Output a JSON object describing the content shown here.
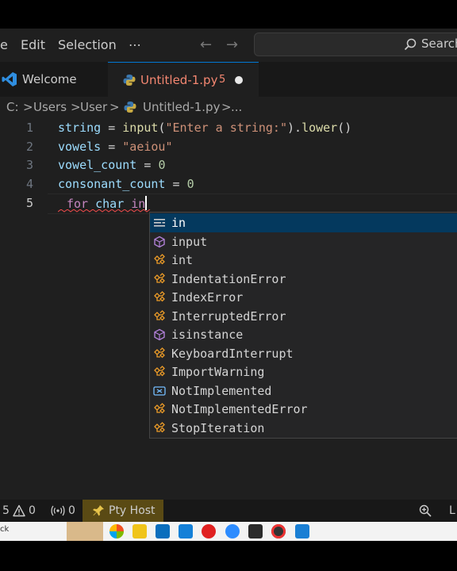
{
  "menu": {
    "item_partial": "e",
    "edit": "Edit",
    "selection": "Selection",
    "more": "⋯"
  },
  "search": {
    "label": "Search"
  },
  "tabs": [
    {
      "label": "Welcome"
    },
    {
      "label": "Untitled-1.py",
      "badge": "5"
    }
  ],
  "breadcrumb": {
    "drive": "C:",
    "sep": ">",
    "users": "Users",
    "user": "User",
    "file": "Untitled-1.py",
    "more": "..."
  },
  "editor": {
    "line_numbers": [
      "1",
      "2",
      "3",
      "4",
      "5"
    ],
    "lines": [
      {
        "var": "string",
        "op": " = ",
        "fn": "input",
        "open": "(",
        "str": "\"Enter a string:\"",
        "close": ").",
        "fn2": "lower",
        "end": "()"
      },
      {
        "var": "vowels",
        "op": " = ",
        "str": "\"aeiou\""
      },
      {
        "var": "vowel_count",
        "op": " = ",
        "num": "0"
      },
      {
        "var": "consonant_count",
        "op": " = ",
        "num": "0"
      },
      {
        "kw": "for",
        "sp": " ",
        "var": "char",
        "sp2": " ",
        "kw2": "in"
      }
    ]
  },
  "suggestions": [
    {
      "label": "in",
      "icon": "keyword-icon"
    },
    {
      "label": "input",
      "icon": "function-icon"
    },
    {
      "label": "int",
      "icon": "class-icon"
    },
    {
      "label": "IndentationError",
      "icon": "class-icon"
    },
    {
      "label": "IndexError",
      "icon": "class-icon"
    },
    {
      "label": "InterruptedError",
      "icon": "class-icon"
    },
    {
      "label": "isinstance",
      "icon": "function-icon"
    },
    {
      "label": "KeyboardInterrupt",
      "icon": "class-icon"
    },
    {
      "label": "ImportWarning",
      "icon": "class-icon"
    },
    {
      "label": "NotImplemented",
      "icon": "variable-icon"
    },
    {
      "label": "NotImplementedError",
      "icon": "class-icon"
    },
    {
      "label": "StopIteration",
      "icon": "class-icon"
    }
  ],
  "status": {
    "errors": "5",
    "warnings": "0",
    "ports": "0",
    "pty": "Pty Host",
    "lang_partial": "L"
  },
  "taskbar": {
    "start_partial": "ck"
  },
  "colors": {
    "accent": "#0078d4",
    "tab_modified": "#f48771",
    "status_pty": "#5a4a14"
  }
}
